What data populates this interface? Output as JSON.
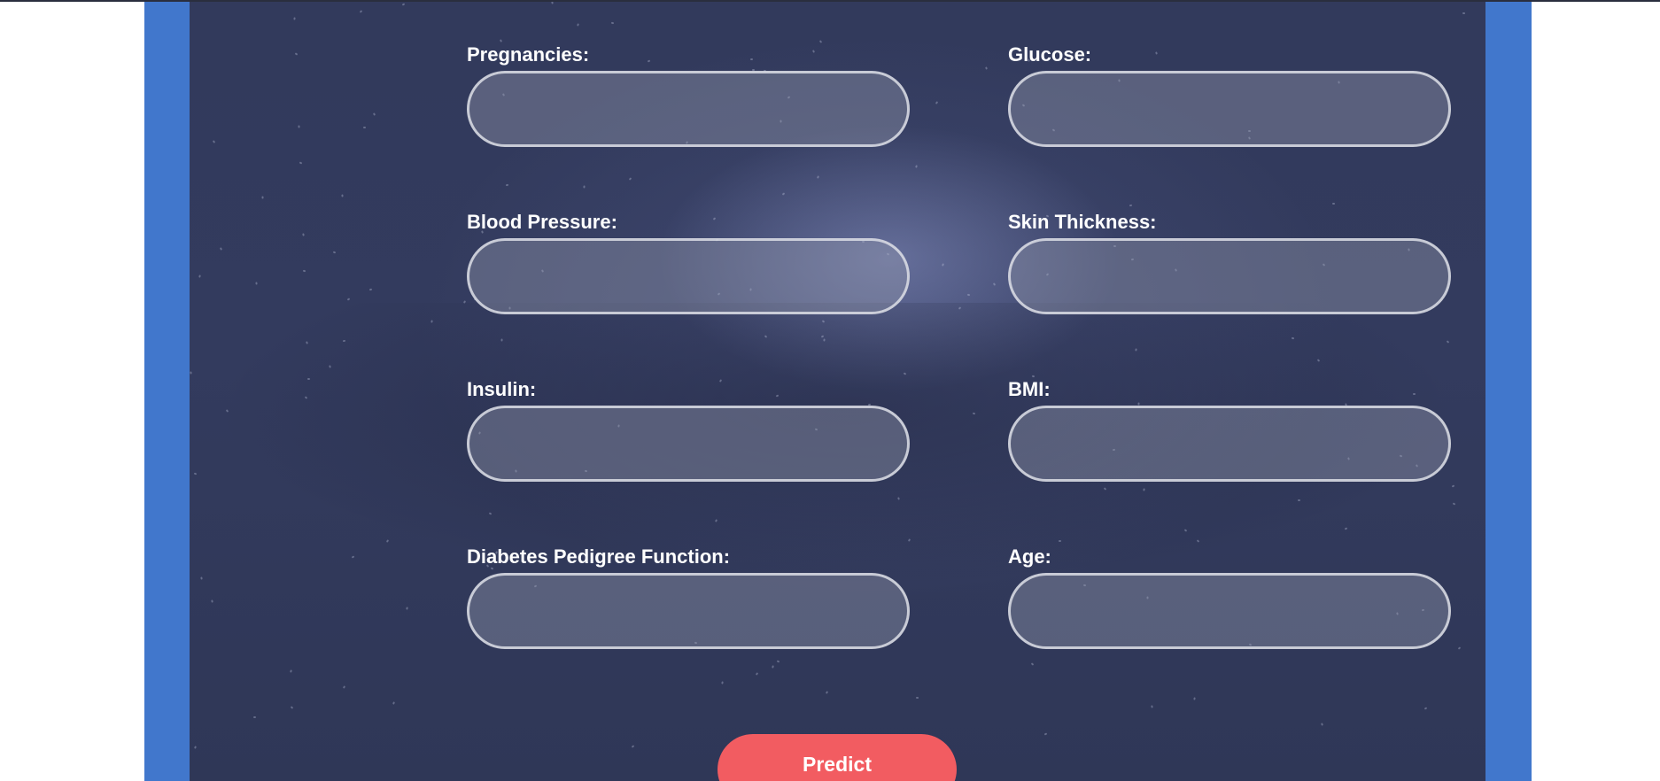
{
  "form": {
    "fields": [
      {
        "label": "Pregnancies:",
        "value": "",
        "placeholder": ""
      },
      {
        "label": "Glucose:",
        "value": "",
        "placeholder": ""
      },
      {
        "label": "Blood Pressure:",
        "value": "",
        "placeholder": ""
      },
      {
        "label": "Skin Thickness:",
        "value": "",
        "placeholder": ""
      },
      {
        "label": "Insulin:",
        "value": "",
        "placeholder": ""
      },
      {
        "label": "BMI:",
        "value": "",
        "placeholder": ""
      },
      {
        "label": "Diabetes Pedigree Function:",
        "value": "",
        "placeholder": ""
      },
      {
        "label": "Age:",
        "value": "",
        "placeholder": ""
      }
    ],
    "submit_label": "Predict"
  },
  "colors": {
    "frame": "#4177cc",
    "panel": "#333b5e",
    "button": "#f25c61",
    "text": "#ffffff"
  }
}
